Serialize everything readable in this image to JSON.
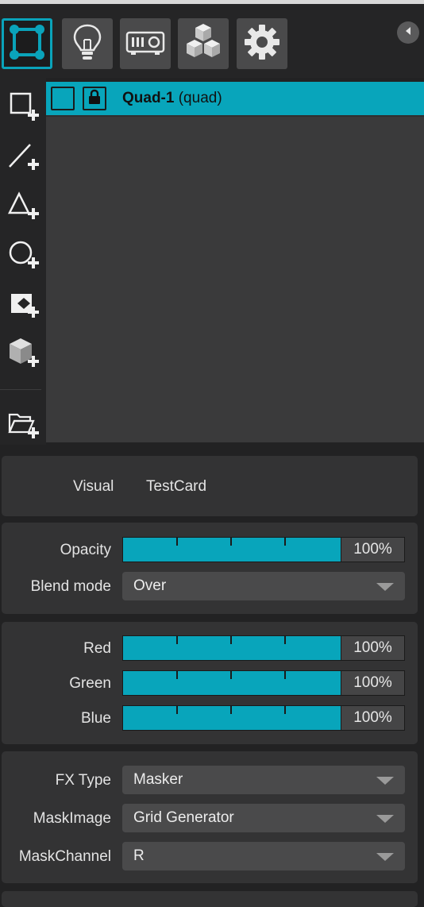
{
  "toolbar": {
    "buttons": [
      {
        "icon": "shape-editor-icon",
        "active": true
      },
      {
        "icon": "lightbulb-icon",
        "active": false
      },
      {
        "icon": "projector-icon",
        "active": false
      },
      {
        "icon": "cubes-icon",
        "active": false
      },
      {
        "icon": "gear-icon",
        "active": false
      }
    ],
    "collapse_icon": "triangle-left-icon"
  },
  "left_tools": [
    {
      "icon": "add-quad-icon"
    },
    {
      "icon": "add-line-icon"
    },
    {
      "icon": "add-triangle-icon"
    },
    {
      "icon": "add-circle-icon"
    },
    {
      "icon": "add-mask-icon"
    },
    {
      "icon": "add-3d-object-icon"
    },
    {
      "icon": "add-from-folder-icon"
    }
  ],
  "layers": [
    {
      "name": "Quad-1",
      "type": "(quad)",
      "selected": true
    }
  ],
  "visual": {
    "label": "Visual",
    "value": "TestCard"
  },
  "opacity": {
    "label": "Opacity",
    "value": "100%",
    "level": 1.0
  },
  "blend": {
    "label": "Blend mode",
    "value": "Over"
  },
  "color": {
    "red": {
      "label": "Red",
      "value": "100%",
      "level": 1.0
    },
    "green": {
      "label": "Green",
      "value": "100%",
      "level": 1.0
    },
    "blue": {
      "label": "Blue",
      "value": "100%",
      "level": 1.0
    }
  },
  "fx": {
    "type_label": "FX Type",
    "type_value": "Masker",
    "mask_image_label": "MaskImage",
    "mask_image_value": "Grid Generator",
    "mask_channel_label": "MaskChannel",
    "mask_channel_value": "R"
  },
  "colors": {
    "accent": "#08a5bb",
    "panel": "#333334",
    "background": "#222223"
  }
}
